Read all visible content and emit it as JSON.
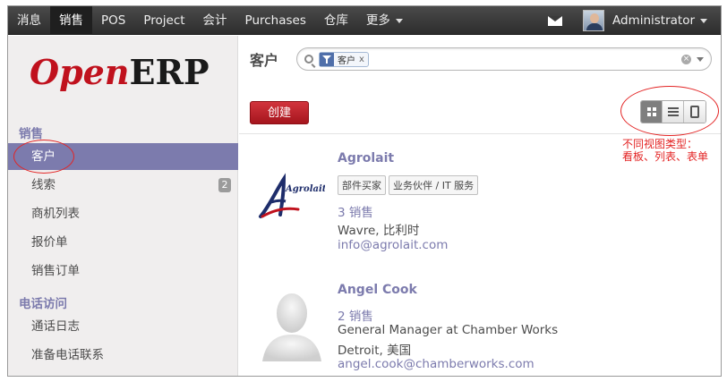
{
  "nav": {
    "menu": [
      "消息",
      "销售",
      "POS",
      "Project",
      "会计",
      "Purchases",
      "仓库",
      "更多"
    ],
    "active_index": 1,
    "user": "Administrator"
  },
  "logo": {
    "part1": "Open",
    "part2": "ERP"
  },
  "sidebar": {
    "sections": [
      {
        "title": "销售",
        "items": [
          {
            "label": "客户",
            "active": true
          },
          {
            "label": "线索",
            "badge": "2"
          },
          {
            "label": "商机列表"
          },
          {
            "label": "报价单"
          },
          {
            "label": "销售订单"
          }
        ]
      },
      {
        "title": "电话访问",
        "items": [
          {
            "label": "通话日志"
          },
          {
            "label": "准备电话联系"
          }
        ]
      }
    ]
  },
  "header": {
    "title": "客户",
    "search_facet": "客户",
    "facet_close": "x",
    "create_label": "创建",
    "annotation_line1": "不同视图类型：",
    "annotation_line2": "看板、列表、表单"
  },
  "view_modes": [
    "kanban",
    "list",
    "form"
  ],
  "active_view": "kanban",
  "cards": [
    {
      "name": "Agrolait",
      "logo_text": "Agrolait",
      "tags": [
        "部件买家",
        "业务伙伴 / IT 服务"
      ],
      "sales": "3 销售",
      "address": "Wavre, 比利时",
      "email": "info@agrolait.com"
    },
    {
      "name": "Angel Cook",
      "sales": "2 销售",
      "title": "General Manager at Chamber Works",
      "address": "Detroit, 美国",
      "email": "angel.cook@chamberworks.com"
    }
  ],
  "colors": {
    "accent": "#7c7bad",
    "create": "#b81c24",
    "annotation": "#e32424",
    "topbar": "#2d2d2d"
  }
}
